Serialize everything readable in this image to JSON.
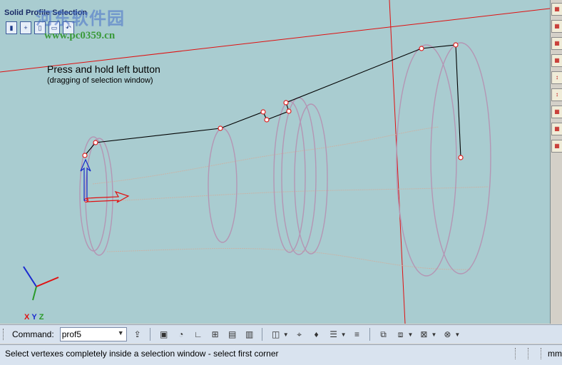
{
  "window": {
    "title": "Solid Profile Selection"
  },
  "watermark": {
    "brand": "河东软件园",
    "url": "www.pc0359.cn"
  },
  "viewport": {
    "instruction_main": "Press and hold left button",
    "instruction_sub": "(dragging of selection window)",
    "axis_x": "X",
    "axis_y": "Y",
    "axis_z": "Z"
  },
  "command_bar": {
    "label": "Command:",
    "value": "prof5"
  },
  "status_bar": {
    "message": "Select vertexes completely inside a selection window - select first corner",
    "unit": "mm"
  },
  "colors": {
    "viewport_bg": "#a9ccd0",
    "profile_line": "#000000",
    "ring": "#b496b4",
    "guide_line": "#e01010",
    "vertex": "#e02020"
  }
}
